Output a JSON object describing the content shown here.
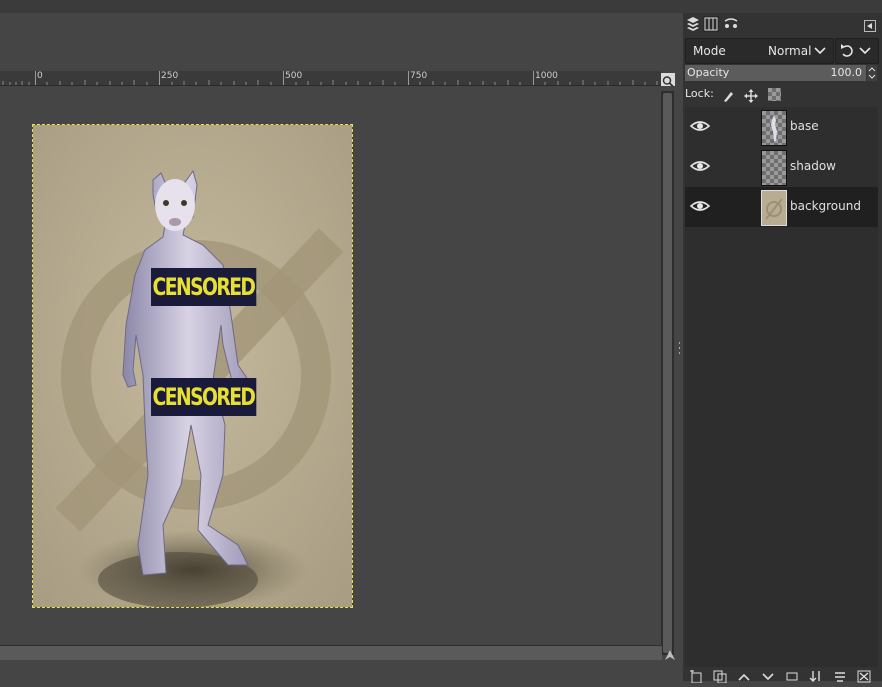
{
  "ruler": {
    "labels": [
      "0",
      "250",
      "500",
      "750",
      "1000"
    ]
  },
  "image": {
    "censor_labels": [
      "CENSORED",
      "CENSORED"
    ]
  },
  "layers_panel": {
    "mode_label": "Mode",
    "mode_value": "Normal",
    "opacity_label": "Opacity",
    "opacity_value": "100.0",
    "opacity_fraction": 1.0,
    "lock_label": "Lock:",
    "layers": [
      {
        "name": "base",
        "visible": true,
        "selected": false,
        "thumb": "figure"
      },
      {
        "name": "shadow",
        "visible": true,
        "selected": false,
        "thumb": "transparent"
      },
      {
        "name": "background",
        "visible": true,
        "selected": true,
        "thumb": "background"
      }
    ]
  },
  "colors": {
    "selection_outline": "#e8e23a",
    "censor_text": "#e8e030",
    "censor_bg": "#1a1a3a",
    "image_bg": "#b8ad92"
  }
}
